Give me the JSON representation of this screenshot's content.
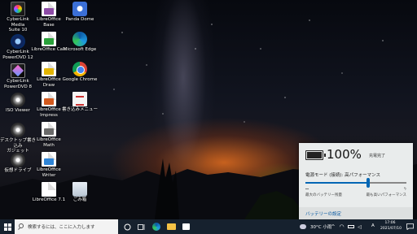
{
  "desktop_icons": [
    {
      "label": "CyberLink Media\nSuite 10",
      "icon": "cyberlink-media-suite-icon"
    },
    {
      "label": "CyberLink\nPowerDVD 12",
      "icon": "powerdvd-icon"
    },
    {
      "label": "CyberLink\nPowerDVD 8",
      "icon": "powerdirector-icon"
    },
    {
      "label": "ISO Viewer",
      "icon": "iso-viewer-icon"
    },
    {
      "label": "デスクトップ書き込み\nガジェット",
      "icon": "desktop-burning-gadget-icon"
    },
    {
      "label": "仮想ドライブ",
      "icon": "virtual-drive-icon"
    },
    {
      "label": "LibreOffice Base",
      "icon": "libreoffice-base-icon"
    },
    {
      "label": "LibreOffice Calc",
      "icon": "libreoffice-calc-icon"
    },
    {
      "label": "LibreOffice Draw",
      "icon": "libreoffice-draw-icon"
    },
    {
      "label": "LibreOffice Impress",
      "icon": "libreoffice-impress-icon"
    },
    {
      "label": "LibreOffice Math",
      "icon": "libreoffice-math-icon"
    },
    {
      "label": "LibreOffice Writer",
      "icon": "libreoffice-writer-icon"
    },
    {
      "label": "LibreOffice 7.1",
      "icon": "libreoffice-icon"
    },
    {
      "label": "Panda Dome",
      "icon": "panda-dome-icon"
    },
    {
      "label": "Microsoft Edge",
      "icon": "edge-icon"
    },
    {
      "label": "Google Chrome",
      "icon": "chrome-icon"
    },
    {
      "label": "書き込みメニュー",
      "icon": "burn-menu-icon"
    },
    {
      "label": "ごみ箱",
      "icon": "recycle-bin-icon"
    }
  ],
  "battery_panel": {
    "percent": "100%",
    "status": "充電完了",
    "mode_label": "電源モード (接続): 高パフォーマンス",
    "slider_level": 0.62,
    "left_caption": "最大のバッテリー残量",
    "right_caption": "最も高いパフォーマンス",
    "settings_link": "バッテリーの設定"
  },
  "taskbar": {
    "search_placeholder": "検索するには、ここに入力します",
    "weather": "30°C 小雨",
    "ime": "A",
    "time": "17:06",
    "date": "2021/07/10"
  },
  "colors": {
    "taskbar_bg": "#16212e",
    "accent": "#0066b4",
    "panel_bg": "#e9ecec"
  }
}
